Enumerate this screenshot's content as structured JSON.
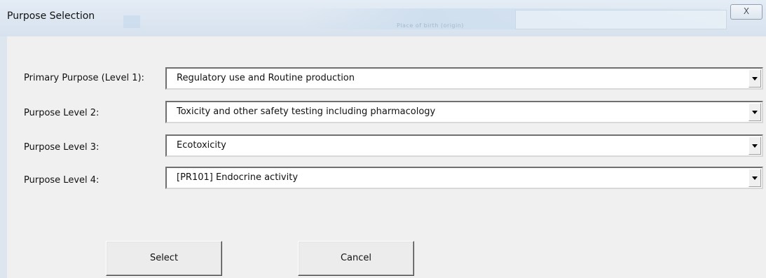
{
  "window": {
    "title": "Purpose Selection",
    "close_glyph": "X",
    "background_ghost_text": "Place of birth (origin)"
  },
  "rows": [
    {
      "label": "Primary Purpose (Level 1):",
      "value": "Regulatory use and Routine production"
    },
    {
      "label": "Purpose Level 2:",
      "value": "Toxicity and other safety testing including  pharmacology"
    },
    {
      "label": "Purpose Level 3:",
      "value": "Ecotoxicity"
    },
    {
      "label": "Purpose Level 4:",
      "value": "[PR101] Endocrine activity"
    }
  ],
  "buttons": {
    "select_label": "Select",
    "cancel_label": "Cancel"
  },
  "icons": {
    "close": "close-icon",
    "dropdown": "chevron-down-icon"
  }
}
